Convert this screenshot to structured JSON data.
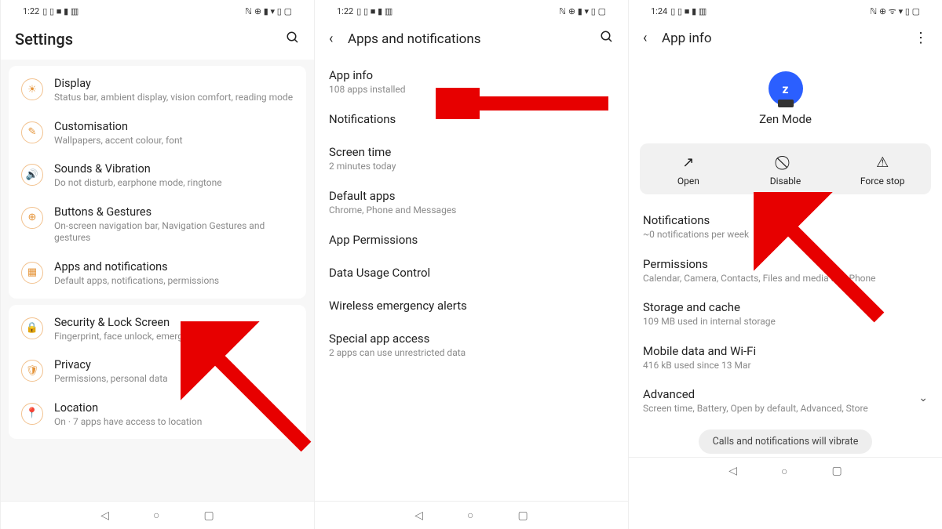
{
  "screen1": {
    "time": "1:22",
    "title": "Settings",
    "groups": [
      [
        {
          "icon": "☀",
          "title": "Display",
          "sub": "Status bar, ambient display, vision comfort, reading mode"
        },
        {
          "icon": "✎",
          "title": "Customisation",
          "sub": "Wallpapers, accent colour, font"
        },
        {
          "icon": "🔊",
          "title": "Sounds & Vibration",
          "sub": "Do not disturb, earphone mode, ringtone"
        },
        {
          "icon": "⊕",
          "title": "Buttons & Gestures",
          "sub": "On-screen navigation bar, Navigation Gestures and gestures"
        },
        {
          "icon": "▦",
          "title": "Apps and notifications",
          "sub": "Default apps, notifications, permissions"
        }
      ],
      [
        {
          "icon": "🔒",
          "title": "Security & Lock Screen",
          "sub": "Fingerprint, face unlock, emergency rescue"
        },
        {
          "icon": "🛡",
          "title": "Privacy",
          "sub": "Permissions, personal data"
        },
        {
          "icon": "📍",
          "title": "Location",
          "sub": "On · 7 apps have access to location"
        }
      ]
    ]
  },
  "screen2": {
    "time": "1:22",
    "title": "Apps and notifications",
    "items": [
      {
        "title": "App info",
        "sub": "108 apps installed"
      },
      {
        "title": "Notifications",
        "sub": ""
      },
      {
        "title": "Screen time",
        "sub": "2 minutes today"
      },
      {
        "title": "Default apps",
        "sub": "Chrome, Phone and Messages"
      },
      {
        "title": "App Permissions",
        "sub": ""
      },
      {
        "title": "Data Usage Control",
        "sub": ""
      },
      {
        "title": "Wireless emergency alerts",
        "sub": ""
      },
      {
        "title": "Special app access",
        "sub": "2 apps can use unrestricted data"
      }
    ]
  },
  "screen3": {
    "time": "1:24",
    "title": "App info",
    "app_name": "Zen Mode",
    "actions": [
      {
        "icon": "↗",
        "label": "Open"
      },
      {
        "icon": "⃠",
        "label": "Disable"
      },
      {
        "icon": "⚠",
        "label": "Force stop"
      }
    ],
    "info": [
      {
        "title": "Notifications",
        "sub": "~0 notifications per week"
      },
      {
        "title": "Permissions",
        "sub": "Calendar, Camera, Contacts, Files and media and Phone"
      },
      {
        "title": "Storage and cache",
        "sub": "109 MB used in internal storage"
      },
      {
        "title": "Mobile data and Wi-Fi",
        "sub": "416 kB used since 13 Mar"
      }
    ],
    "advanced": {
      "title": "Advanced",
      "sub": "Screen time, Battery, Open by default, Advanced, Store"
    },
    "toast": "Calls and notifications will vibrate"
  },
  "status_icons_left": "▯ ▯ ■ ▮ ▥",
  "status_icons_right": "ℕ ⊕ ▮ ▾ ▯ ▢",
  "status_icons_right3": "ℕ ⊕ ᯤ ▾ ▯ ▢"
}
